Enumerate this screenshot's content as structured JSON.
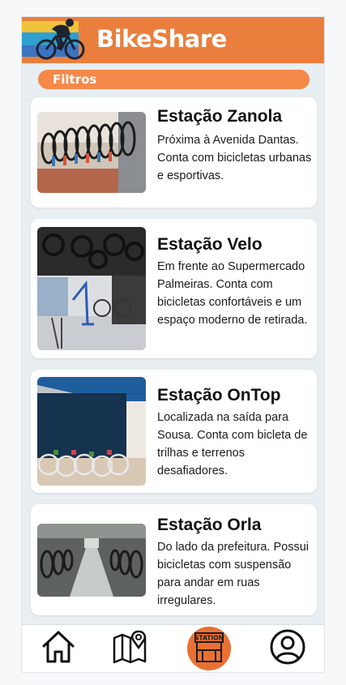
{
  "app": {
    "title": "BikeShare"
  },
  "filters": {
    "label": "Filtros"
  },
  "stations": [
    {
      "title": "Estação Zanola",
      "description": "Próxima à Avenida Dantas. Conta com bicicletas urbanas e esportivas."
    },
    {
      "title": "Estação Velo",
      "description": "Em frente ao Supermercado Palmeiras. Conta com bicicletas confortáveis e um espaço moderno de retirada."
    },
    {
      "title": "Estação OnTop",
      "description": "Localizada na saída para Sousa. Conta com bicleta de trilhas e terrenos desafiadores."
    },
    {
      "title": "Estação Orla",
      "description": "Do lado da prefeitura. Possui bicicletas com suspensão para andar em ruas irregulares."
    }
  ],
  "nav": {
    "items": [
      {
        "icon": "home-icon"
      },
      {
        "icon": "map-icon"
      },
      {
        "icon": "station-icon",
        "label": "STATION",
        "active": true
      },
      {
        "icon": "profile-icon"
      }
    ]
  },
  "colors": {
    "header": "#ea7f3d",
    "filters": "#f5894a",
    "active_nav": "#ea7034"
  }
}
